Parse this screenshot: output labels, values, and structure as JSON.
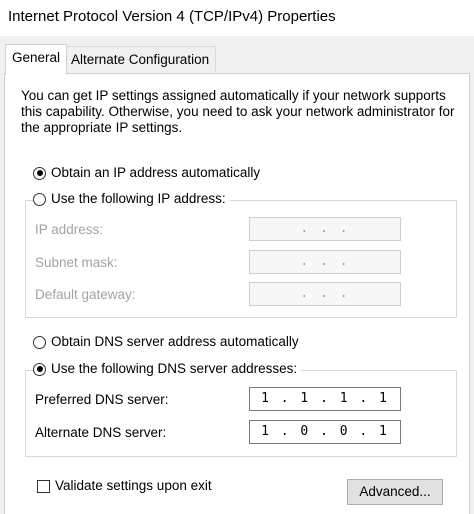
{
  "window": {
    "title": "Internet Protocol Version 4 (TCP/IPv4) Properties"
  },
  "tabs": [
    {
      "label": "General",
      "active": true
    },
    {
      "label": "Alternate Configuration",
      "active": false
    }
  ],
  "general": {
    "intro": "You can get IP settings assigned automatically if your network supports this capability. Otherwise, you need to ask your network administrator for the appropriate IP settings.",
    "ip_mode": {
      "auto_label": "Obtain an IP address automatically",
      "manual_label": "Use the following IP address:",
      "selected": "auto"
    },
    "ip_fields": [
      {
        "label": "IP address:",
        "value": ".    .    ."
      },
      {
        "label": "Subnet mask:",
        "value": ".    .    ."
      },
      {
        "label": "Default gateway:",
        "value": ".    .    ."
      }
    ],
    "dns_mode": {
      "auto_label": "Obtain DNS server address automatically",
      "manual_label": "Use the following DNS server addresses:",
      "selected": "manual"
    },
    "dns_fields": [
      {
        "label": "Preferred DNS server:",
        "value": "1 . 1 . 1 . 1"
      },
      {
        "label": "Alternate DNS server:",
        "value": "1 . 0 . 0 . 1"
      }
    ],
    "validate_label": "Validate settings upon exit",
    "validate_checked": false,
    "advanced_label": "Advanced..."
  }
}
